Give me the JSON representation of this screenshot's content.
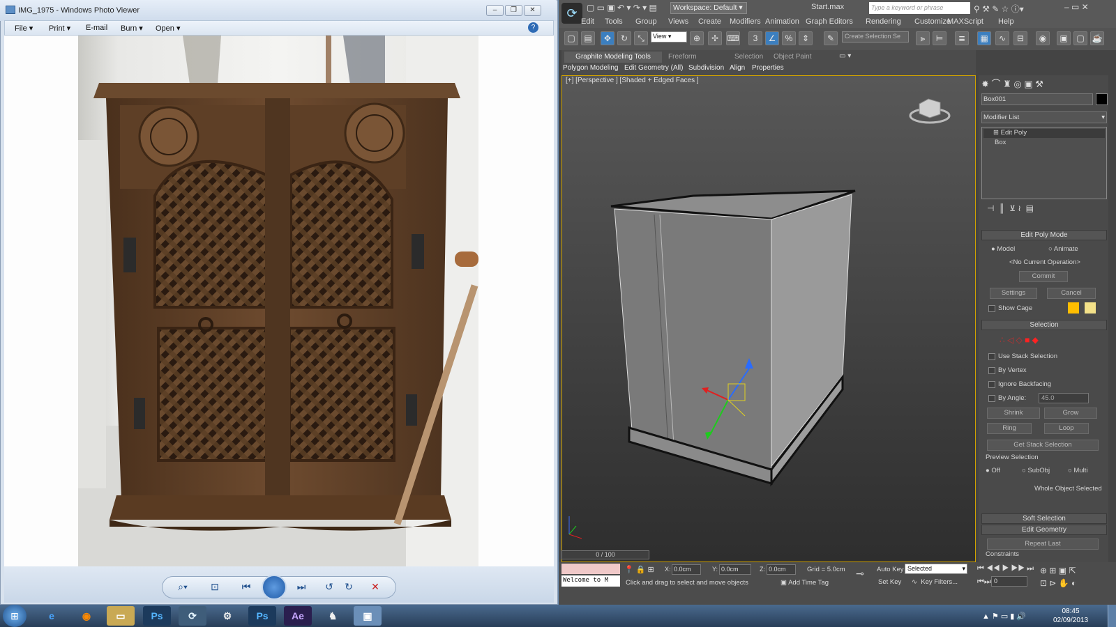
{
  "photo_viewer": {
    "title": "IMG_1975 - Windows Photo Viewer",
    "menu": [
      "File",
      "Print",
      "E-mail",
      "Burn",
      "Open"
    ],
    "window_buttons": [
      "minimize",
      "restore",
      "close"
    ]
  },
  "max": {
    "file_title": "Start.max",
    "workspace": "Workspace: Default",
    "search_placeholder": "Type a keyword or phrase",
    "menu": [
      "Edit",
      "Tools",
      "Group",
      "Views",
      "Create",
      "Modifiers",
      "Animation",
      "Graph Editors",
      "Rendering",
      "Customize",
      "MAXScript",
      "Help"
    ],
    "view_dropdown": "View",
    "selection_set_placeholder": "Create Selection Se",
    "ribbon_tabs": [
      "Graphite Modeling Tools",
      "Freeform",
      "Selection",
      "Object Paint"
    ],
    "ribbon_panels": [
      "Polygon Modeling",
      "Edit",
      "Geometry (All)",
      "Subdivision",
      "Align",
      "Properties"
    ],
    "viewport_label": "[+] [Perspective ] [Shaded + Edged Faces ]",
    "object_name": "Box001",
    "modifier_list": "Modifier List",
    "stack": [
      "Edit Poly",
      "Box"
    ],
    "edit_poly_mode": {
      "header": "Edit Poly Mode",
      "model": "Model",
      "animate": "Animate",
      "current_op": "<No Current Operation>",
      "commit": "Commit",
      "settings": "Settings",
      "cancel": "Cancel",
      "show_cage": "Show Cage"
    },
    "selection": {
      "header": "Selection",
      "use_stack": "Use Stack Selection",
      "by_vertex": "By Vertex",
      "ignore_backfacing": "Ignore Backfacing",
      "by_angle": "By Angle:",
      "angle_value": "45.0",
      "shrink": "Shrink",
      "grow": "Grow",
      "ring": "Ring",
      "loop": "Loop",
      "get_stack": "Get Stack Selection",
      "preview": "Preview Selection",
      "off": "Off",
      "subobj": "SubObj",
      "multi": "Multi",
      "whole": "Whole Object Selected"
    },
    "rollouts": [
      "Soft Selection",
      "Edit Geometry"
    ],
    "repeat_last": "Repeat Last",
    "constraints": "Constraints",
    "timeline": "0 / 100",
    "welcome": "Welcome to M",
    "x": "0.0cm",
    "y": "0.0cm",
    "z": "0.0cm",
    "grid": "Grid = 5.0cm",
    "auto_key": "Auto Key",
    "set_key": "Set Key",
    "selected": "Selected",
    "key_filters": "Key Filters...",
    "frame": "0",
    "prompt": "Click and drag to select and move objects",
    "add_time_tag": "Add Time Tag"
  },
  "taskbar": {
    "clock_time": "08:45",
    "clock_date": "02/09/2013",
    "apps": [
      "IE",
      "Firefox",
      "Explorer",
      "Ps",
      "3ds Max",
      "App",
      "Ps",
      "Ae",
      "App",
      "Photo Viewer"
    ]
  }
}
